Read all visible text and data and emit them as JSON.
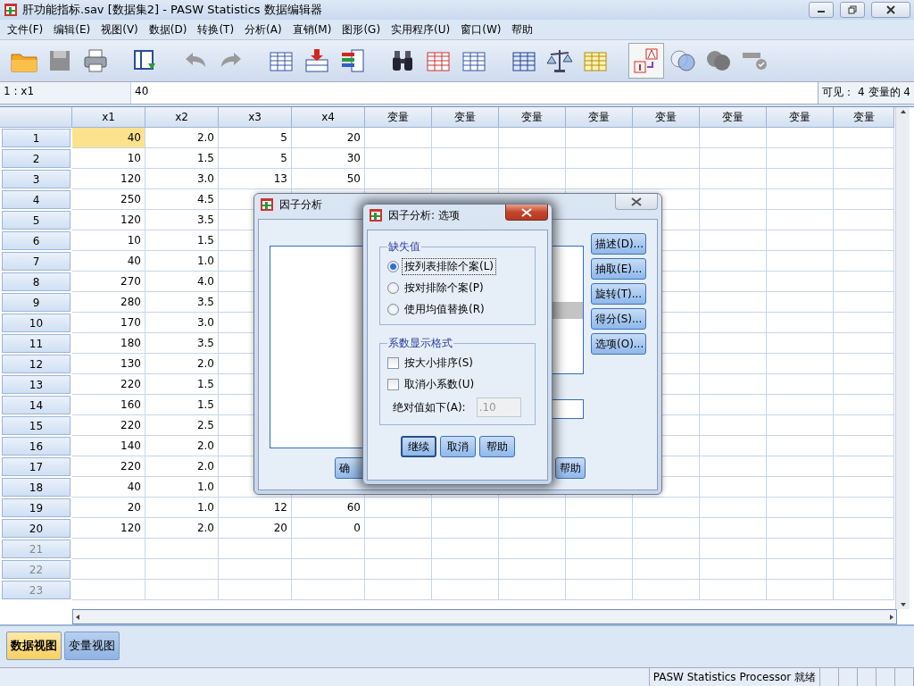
{
  "window": {
    "title": "肝功能指标.sav [数据集2] - PASW Statistics 数据编辑器"
  },
  "menu": [
    "文件(F)",
    "编辑(E)",
    "视图(V)",
    "数据(D)",
    "转换(T)",
    "分析(A)",
    "直销(M)",
    "图形(G)",
    "实用程序(U)",
    "窗口(W)",
    "帮助"
  ],
  "cell_bar": {
    "reference": "1 : x1",
    "value": "40",
    "visible": "可见： 4 变量的 4"
  },
  "table": {
    "columns": [
      "x1",
      "x2",
      "x3",
      "x4",
      "变量",
      "变量",
      "变量",
      "变量",
      "变量",
      "变量",
      "变量",
      "变量"
    ],
    "rows": [
      {
        "number": "1",
        "cells": [
          {
            "value": "40",
            "selected": true
          },
          {
            "value": "2.0",
            "selected": false
          },
          {
            "value": "5",
            "selected": false
          },
          {
            "value": "20",
            "selected": false
          }
        ]
      },
      {
        "number": "2",
        "cells": [
          {
            "value": "10",
            "selected": false
          },
          {
            "value": "1.5",
            "selected": false
          },
          {
            "value": "5",
            "selected": false
          },
          {
            "value": "30",
            "selected": false
          }
        ]
      },
      {
        "number": "3",
        "cells": [
          {
            "value": "120",
            "selected": false
          },
          {
            "value": "3.0",
            "selected": false
          },
          {
            "value": "13",
            "selected": false
          },
          {
            "value": "50",
            "selected": false
          }
        ]
      },
      {
        "number": "4",
        "cells": [
          {
            "value": "250",
            "selected": false
          },
          {
            "value": "4.5",
            "selected": false
          }
        ]
      },
      {
        "number": "5",
        "cells": [
          {
            "value": "120",
            "selected": false
          },
          {
            "value": "3.5",
            "selected": false
          }
        ]
      },
      {
        "number": "6",
        "cells": [
          {
            "value": "10",
            "selected": false
          },
          {
            "value": "1.5",
            "selected": false
          }
        ]
      },
      {
        "number": "7",
        "cells": [
          {
            "value": "40",
            "selected": false
          },
          {
            "value": "1.0",
            "selected": false
          }
        ]
      },
      {
        "number": "8",
        "cells": [
          {
            "value": "270",
            "selected": false
          },
          {
            "value": "4.0",
            "selected": false
          }
        ]
      },
      {
        "number": "9",
        "cells": [
          {
            "value": "280",
            "selected": false
          },
          {
            "value": "3.5",
            "selected": false
          }
        ]
      },
      {
        "number": "10",
        "cells": [
          {
            "value": "170",
            "selected": false
          },
          {
            "value": "3.0",
            "selected": false
          }
        ]
      },
      {
        "number": "11",
        "cells": [
          {
            "value": "180",
            "selected": false
          },
          {
            "value": "3.5",
            "selected": false
          }
        ]
      },
      {
        "number": "12",
        "cells": [
          {
            "value": "130",
            "selected": false
          },
          {
            "value": "2.0",
            "selected": false
          }
        ]
      },
      {
        "number": "13",
        "cells": [
          {
            "value": "220",
            "selected": false
          },
          {
            "value": "1.5",
            "selected": false
          }
        ]
      },
      {
        "number": "14",
        "cells": [
          {
            "value": "160",
            "selected": false
          },
          {
            "value": "1.5",
            "selected": false
          }
        ]
      },
      {
        "number": "15",
        "cells": [
          {
            "value": "220",
            "selected": false
          },
          {
            "value": "2.5",
            "selected": false
          }
        ]
      },
      {
        "number": "16",
        "cells": [
          {
            "value": "140",
            "selected": false
          },
          {
            "value": "2.0",
            "selected": false
          }
        ]
      },
      {
        "number": "17",
        "cells": [
          {
            "value": "220",
            "selected": false
          },
          {
            "value": "2.0",
            "selected": false
          }
        ]
      },
      {
        "number": "18",
        "cells": [
          {
            "value": "40",
            "selected": false
          },
          {
            "value": "1.0",
            "selected": false
          }
        ]
      },
      {
        "number": "19",
        "cells": [
          {
            "value": "20",
            "selected": false
          },
          {
            "value": "1.0",
            "selected": false
          },
          {
            "value": "12",
            "selected": false
          },
          {
            "value": "60",
            "selected": false
          }
        ]
      },
      {
        "number": "20",
        "cells": [
          {
            "value": "120",
            "selected": false
          },
          {
            "value": "2.0",
            "selected": false
          },
          {
            "value": "20",
            "selected": false
          },
          {
            "value": "0",
            "selected": false
          }
        ]
      },
      {
        "number": "21",
        "cells": []
      },
      {
        "number": "22",
        "cells": []
      },
      {
        "number": "23",
        "cells": []
      }
    ]
  },
  "view_tabs": [
    {
      "label": "数据视图",
      "selected": true
    },
    {
      "label": "变量视图",
      "selected": false
    }
  ],
  "status_bar": {
    "text": "PASW Statistics Processor 就绪"
  },
  "factor_dialog": {
    "title": "因子分析",
    "side_buttons": [
      "描述(D)...",
      "抽取(E)...",
      "旋转(T)...",
      "得分(S)...",
      "选项(O)..."
    ],
    "bottom_buttons": [
      "确",
      "帮助"
    ]
  },
  "options_dialog": {
    "title": "因子分析: 选项",
    "missing_values": {
      "label": "缺失值",
      "options": [
        {
          "label": "按列表排除个案(L)",
          "selected": true
        },
        {
          "label": "按对排除个案(P)",
          "selected": false
        },
        {
          "label": "使用均值替换(R)",
          "selected": false
        }
      ]
    },
    "coefficient_format": {
      "label": "系数显示格式",
      "options": [
        {
          "label": "按大小排序(S)",
          "checked": false
        },
        {
          "label": "取消小系数(U)",
          "checked": false
        }
      ],
      "threshold_label": "绝对值如下(A):",
      "threshold_value": ".10",
      "threshold_disabled": true
    },
    "buttons": [
      "继续",
      "取消",
      "帮助"
    ]
  }
}
